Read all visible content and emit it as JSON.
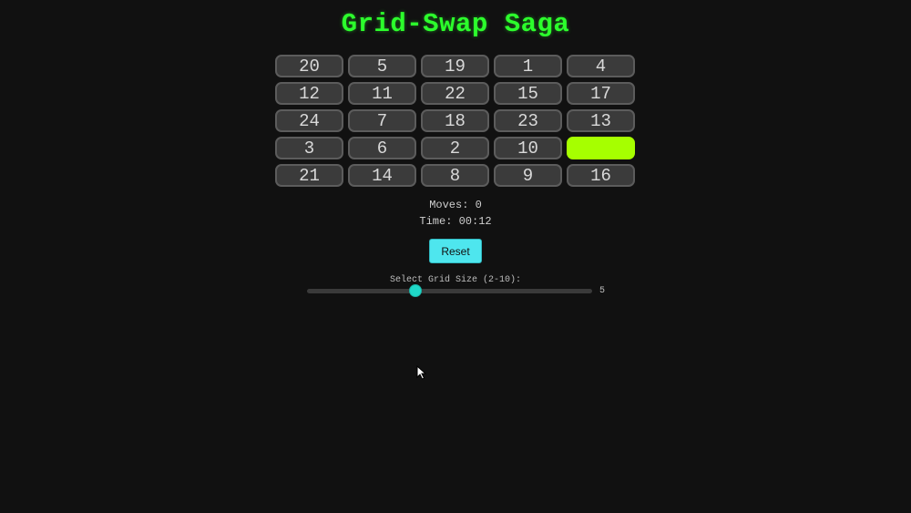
{
  "title": "Grid-Swap Saga",
  "grid": {
    "size": 5,
    "tiles": [
      "20",
      "5",
      "19",
      "1",
      "4",
      "12",
      "11",
      "22",
      "15",
      "17",
      "24",
      "7",
      "18",
      "23",
      "13",
      "3",
      "6",
      "2",
      "10",
      "",
      "21",
      "14",
      "8",
      "9",
      "16"
    ],
    "empty_index": 19,
    "colors": {
      "tile_bg": "#3b3b3b",
      "empty_tile": "#a6ff00"
    }
  },
  "stats": {
    "moves_label": "Moves: 0",
    "time_label": "Time: 00:12"
  },
  "controls": {
    "reset_label": "Reset",
    "grid_size_label": "Select Grid Size (2-10):",
    "grid_size_value": "5",
    "grid_size_min": 2,
    "grid_size_max": 10
  },
  "colors": {
    "title": "#2cff2c",
    "accent": "#4ee6ee",
    "slider_thumb": "#1fd8c8",
    "background": "#111111"
  },
  "icons": {
    "cursor": "mouse-pointer-icon"
  }
}
